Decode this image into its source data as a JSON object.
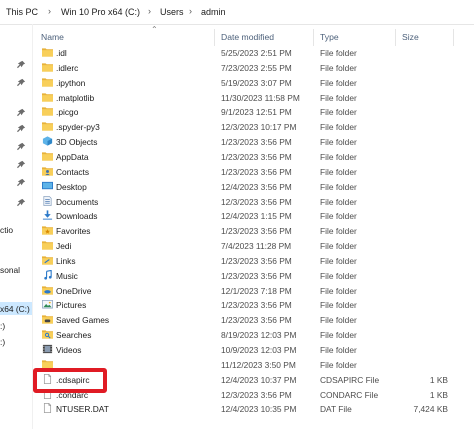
{
  "breadcrumb": {
    "items": [
      "This PC",
      "Win 10 Pro x64 (C:)",
      "Users",
      "admin"
    ],
    "separator": "›"
  },
  "navpane": {
    "labels": [
      "ctio",
      "sonal",
      "x64 (C:)",
      ":)",
      ":)"
    ],
    "pins": 8
  },
  "columns": {
    "name": "Name",
    "date": "Date modified",
    "type": "Type",
    "size": "Size"
  },
  "files": [
    {
      "name": ".idl",
      "date": "5/25/2023 2:51 PM",
      "type": "File folder",
      "size": "",
      "icon": "folder-icon"
    },
    {
      "name": ".idlerc",
      "date": "7/23/2023 2:55 PM",
      "type": "File folder",
      "size": "",
      "icon": "folder-icon"
    },
    {
      "name": ".ipython",
      "date": "5/19/2023 3:07 PM",
      "type": "File folder",
      "size": "",
      "icon": "folder-icon"
    },
    {
      "name": ".matplotlib",
      "date": "11/30/2023 11:58 PM",
      "type": "File folder",
      "size": "",
      "icon": "folder-icon"
    },
    {
      "name": ".picgo",
      "date": "9/1/2023 12:51 PM",
      "type": "File folder",
      "size": "",
      "icon": "folder-icon"
    },
    {
      "name": ".spyder-py3",
      "date": "12/3/2023 10:17 PM",
      "type": "File folder",
      "size": "",
      "icon": "folder-icon"
    },
    {
      "name": "3D Objects",
      "date": "1/23/2023 3:56 PM",
      "type": "File folder",
      "size": "",
      "icon": "3d-objects-icon"
    },
    {
      "name": "AppData",
      "date": "1/23/2023 3:56 PM",
      "type": "File folder",
      "size": "",
      "icon": "folder-icon"
    },
    {
      "name": "Contacts",
      "date": "1/23/2023 3:56 PM",
      "type": "File folder",
      "size": "",
      "icon": "contacts-icon"
    },
    {
      "name": "Desktop",
      "date": "12/4/2023 3:56 PM",
      "type": "File folder",
      "size": "",
      "icon": "desktop-icon"
    },
    {
      "name": "Documents",
      "date": "12/3/2023 3:56 PM",
      "type": "File folder",
      "size": "",
      "icon": "documents-icon"
    },
    {
      "name": "Downloads",
      "date": "12/4/2023 1:15 PM",
      "type": "File folder",
      "size": "",
      "icon": "downloads-icon"
    },
    {
      "name": "Favorites",
      "date": "1/23/2023 3:56 PM",
      "type": "File folder",
      "size": "",
      "icon": "favorites-icon"
    },
    {
      "name": "Jedi",
      "date": "7/4/2023 11:28 PM",
      "type": "File folder",
      "size": "",
      "icon": "folder-icon"
    },
    {
      "name": "Links",
      "date": "1/23/2023 3:56 PM",
      "type": "File folder",
      "size": "",
      "icon": "links-icon"
    },
    {
      "name": "Music",
      "date": "1/23/2023 3:56 PM",
      "type": "File folder",
      "size": "",
      "icon": "music-icon"
    },
    {
      "name": "OneDrive",
      "date": "12/1/2023 7:18 PM",
      "type": "File folder",
      "size": "",
      "icon": "onedrive-icon"
    },
    {
      "name": "Pictures",
      "date": "1/23/2023 3:56 PM",
      "type": "File folder",
      "size": "",
      "icon": "pictures-icon"
    },
    {
      "name": "Saved Games",
      "date": "1/23/2023 3:56 PM",
      "type": "File folder",
      "size": "",
      "icon": "saved-games-icon"
    },
    {
      "name": "Searches",
      "date": "8/19/2023 12:03 PM",
      "type": "File folder",
      "size": "",
      "icon": "searches-icon"
    },
    {
      "name": "Videos",
      "date": "10/9/2023 12:03 PM",
      "type": "File folder",
      "size": "",
      "icon": "videos-icon"
    },
    {
      "name": "",
      "date": "11/12/2023 3:50 PM",
      "type": "File folder",
      "size": "",
      "icon": "folder-icon"
    },
    {
      "name": ".cdsapirc",
      "date": "12/4/2023 10:37 PM",
      "type": "CDSAPIRC File",
      "size": "1 KB",
      "icon": "file-icon"
    },
    {
      "name": ".condarc",
      "date": "12/3/2023 3:56 PM",
      "type": "CONDARC File",
      "size": "1 KB",
      "icon": "file-icon"
    },
    {
      "name": "NTUSER.DAT",
      "date": "12/4/2023 10:35 PM",
      "type": "DAT File",
      "size": "7,424 KB",
      "icon": "file-icon"
    }
  ],
  "colors": {
    "accent": "#cce8ff",
    "highlight": "#e01b24",
    "header_text": "#4c607a",
    "folder": "#f6c443"
  }
}
